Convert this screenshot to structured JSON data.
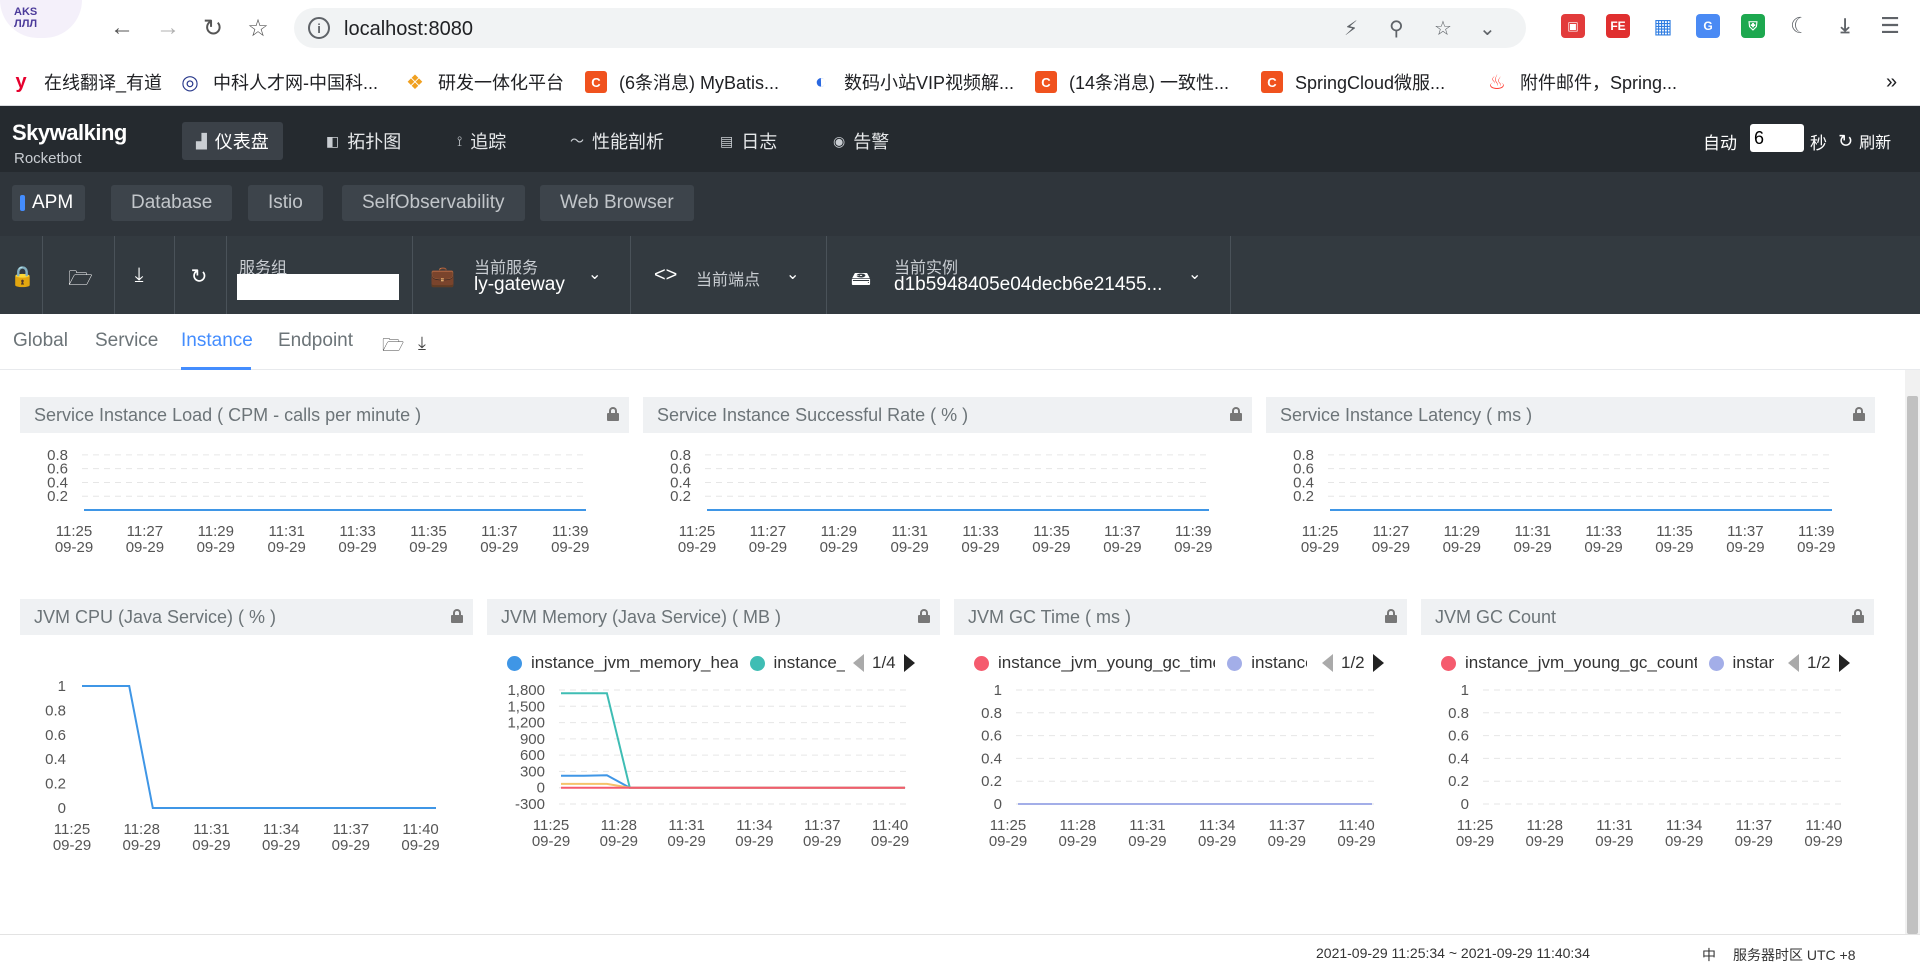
{
  "browser": {
    "url": "localhost:8080",
    "icons": [
      "back-icon",
      "forward-icon",
      "reload-icon",
      "bookmark-star-icon",
      "site-info-icon",
      "lightning-icon",
      "zoom-icon",
      "star-icon",
      "chevron-down-icon",
      "menu-icon"
    ]
  },
  "bookmarks": [
    {
      "label": "在线翻译_有道",
      "color": "#e6002d",
      "glyph": "y"
    },
    {
      "label": "中科人才网-中国科...",
      "color": "#2a3a8c",
      "glyph": "◎"
    },
    {
      "label": "研发一体化平台",
      "color": "#f0a020",
      "glyph": "❖"
    },
    {
      "label": "(6条消息) MyBatis...",
      "color": "#f0521e",
      "glyph": "C"
    },
    {
      "label": "数码小站VIP视频解...",
      "color": "#2a68e0",
      "glyph": "◐"
    },
    {
      "label": "(14条消息) 一致性...",
      "color": "#f0521e",
      "glyph": "C"
    },
    {
      "label": "SpringCloud微服...",
      "color": "#f0521e",
      "glyph": "C"
    },
    {
      "label": "附件邮件，Spring...",
      "color": "#ff3b30",
      "glyph": "♨"
    }
  ],
  "bookmarks_more": "»",
  "header": {
    "logo_title": "Skywalking",
    "logo_sub": "Rocketbot",
    "nav": [
      {
        "label": "仪表盘",
        "icon": "▟"
      },
      {
        "label": "拓扑图",
        "icon": "◧"
      },
      {
        "label": "追踪",
        "icon": "⟟"
      },
      {
        "label": "性能剖析",
        "icon": "〜"
      },
      {
        "label": "日志",
        "icon": "▤"
      },
      {
        "label": "告警",
        "icon": "◉"
      }
    ],
    "auto_label": "自动",
    "auto_value": "6",
    "sec_label": "秒",
    "refresh_label": "刷新"
  },
  "layers": [
    "APM",
    "Database",
    "Istio",
    "SelfObservability",
    "Web Browser"
  ],
  "toolbar": {
    "group_label": "服务组",
    "service_label": "当前服务",
    "service_value": "ly-gateway",
    "endpoint_label": "当前端点",
    "instance_label": "当前实例",
    "instance_value": "d1b5948405e04decb6e21455..."
  },
  "dash_tabs": [
    "Global",
    "Service",
    "Instance",
    "Endpoint"
  ],
  "footer": {
    "time_range": "2021-09-29 11:25:34 ~ 2021-09-29 11:40:34",
    "lang": "中",
    "timezone": "服务器时区 UTC +8"
  },
  "panels": {
    "load_title": "Service Instance Load ( CPM - calls per minute )",
    "sr_title": "Service Instance Successful Rate ( % )",
    "latency_title": "Service Instance Latency ( ms )",
    "cpu_title": "JVM CPU (Java Service) ( % )",
    "mem_title": "JVM Memory (Java Service) ( MB )",
    "gctime_title": "JVM GC Time ( ms )",
    "gccount_title": "JVM GC Count",
    "mem_legend": [
      "instance_jvm_memory_heap",
      "instance_jvm_memory_heap_max"
    ],
    "mem_page": "1/4",
    "gctime_legend": [
      "instance_jvm_young_gc_time",
      "instance_jvm_old_gc_time"
    ],
    "gctime_page": "1/2",
    "gccount_legend": [
      "instance_jvm_young_gc_count",
      "instance_jvm_old_gc_count"
    ],
    "gccount_page": "1/2"
  },
  "colors": {
    "accent": "#448dfe",
    "blue": "#3f96e6",
    "teal": "#3fbdb4",
    "orange": "#f5c26b",
    "red": "#f55b6e",
    "lavender": "#a3aee8"
  },
  "chart_data": [
    {
      "type": "line",
      "title": "Service Instance Load ( CPM - calls per minute )",
      "x": [
        "11:25\n09-29",
        "11:27\n09-29",
        "11:29\n09-29",
        "11:31\n09-29",
        "11:33\n09-29",
        "11:35\n09-29",
        "11:37\n09-29",
        "11:39\n09-29"
      ],
      "yticks": [
        0.2,
        0.4,
        0.6,
        0.8
      ],
      "ylim": [
        0,
        0.9
      ],
      "series": [
        {
          "values": [
            0,
            0,
            0,
            0,
            0,
            0,
            0,
            0,
            0,
            0,
            0,
            0,
            0,
            0,
            0,
            0
          ]
        }
      ]
    },
    {
      "type": "line",
      "title": "Service Instance Successful Rate ( % )",
      "x": [
        "11:25\n09-29",
        "11:27\n09-29",
        "11:29\n09-29",
        "11:31\n09-29",
        "11:33\n09-29",
        "11:35\n09-29",
        "11:37\n09-29",
        "11:39\n09-29"
      ],
      "yticks": [
        0.2,
        0.4,
        0.6,
        0.8
      ],
      "ylim": [
        0,
        0.9
      ],
      "series": [
        {
          "values": [
            0,
            0,
            0,
            0,
            0,
            0,
            0,
            0,
            0,
            0,
            0,
            0,
            0,
            0,
            0,
            0
          ]
        }
      ]
    },
    {
      "type": "line",
      "title": "Service Instance Latency ( ms )",
      "x": [
        "11:25\n09-29",
        "11:27\n09-29",
        "11:29\n09-29",
        "11:31\n09-29",
        "11:33\n09-29",
        "11:35\n09-29",
        "11:37\n09-29",
        "11:39\n09-29"
      ],
      "yticks": [
        0.2,
        0.4,
        0.6,
        0.8
      ],
      "ylim": [
        0,
        0.9
      ],
      "series": [
        {
          "values": [
            0,
            0,
            0,
            0,
            0,
            0,
            0,
            0,
            0,
            0,
            0,
            0,
            0,
            0,
            0,
            0
          ]
        }
      ]
    },
    {
      "type": "line",
      "title": "JVM CPU (Java Service) ( % )",
      "x": [
        "11:25\n09-29",
        "11:28\n09-29",
        "11:31\n09-29",
        "11:34\n09-29",
        "11:37\n09-29",
        "11:40\n09-29"
      ],
      "yticks": [
        0,
        0.2,
        0.4,
        0.6,
        0.8,
        1
      ],
      "ylim": [
        0,
        1
      ],
      "grid": false,
      "series": [
        {
          "values": [
            1,
            1,
            1,
            0,
            0,
            0,
            0,
            0,
            0,
            0,
            0,
            0,
            0,
            0,
            0,
            0
          ]
        }
      ]
    },
    {
      "type": "line",
      "title": "JVM Memory (Java Service) ( MB )",
      "x": [
        "11:25\n09-29",
        "11:28\n09-29",
        "11:31\n09-29",
        "11:34\n09-29",
        "11:37\n09-29",
        "11:40\n09-29"
      ],
      "yticks": [
        -300,
        0,
        300,
        600,
        900,
        1200,
        1500,
        1800
      ],
      "yticklabels": [
        "-300",
        "0",
        "300",
        "600",
        "900",
        "1,200",
        "1,500",
        "1,800"
      ],
      "ylim": [
        -300,
        1800
      ],
      "series": [
        {
          "name": "instance_jvm_memory_heap",
          "values": [
            220,
            220,
            230,
            0,
            0,
            0,
            0,
            0,
            0,
            0,
            0,
            0,
            0,
            0,
            0,
            0
          ]
        },
        {
          "name": "instance_jvm_memory_heap_max",
          "values": [
            1740,
            1740,
            1740,
            0,
            0,
            0,
            0,
            0,
            0,
            0,
            0,
            0,
            0,
            0,
            0,
            0
          ]
        },
        {
          "values": [
            70,
            70,
            70,
            0,
            0,
            0,
            0,
            0,
            0,
            0,
            0,
            0,
            0,
            0,
            0,
            0
          ]
        },
        {
          "values": [
            0,
            0,
            0,
            0,
            0,
            0,
            0,
            0,
            0,
            0,
            0,
            0,
            0,
            0,
            0,
            0
          ]
        }
      ]
    },
    {
      "type": "line",
      "title": "JVM GC Time ( ms )",
      "x": [
        "11:25\n09-29",
        "11:28\n09-29",
        "11:31\n09-29",
        "11:34\n09-29",
        "11:37\n09-29",
        "11:40\n09-29"
      ],
      "yticks": [
        0,
        0.2,
        0.4,
        0.6,
        0.8,
        1
      ],
      "ylim": [
        0,
        1
      ],
      "series": [
        {
          "name": "instance_jvm_young_gc_time",
          "values": [
            0,
            0,
            0,
            0,
            0,
            0,
            0,
            0,
            0,
            0,
            0,
            0,
            0,
            0,
            0,
            0
          ]
        },
        {
          "name": "instance_jvm_old_gc_time",
          "values": [
            0,
            0,
            0,
            0,
            0,
            0,
            0,
            0,
            0,
            0,
            0,
            0,
            0,
            0,
            0,
            0
          ]
        }
      ]
    },
    {
      "type": "line",
      "title": "JVM GC Count",
      "x": [
        "11:25\n09-29",
        "11:28\n09-29",
        "11:31\n09-29",
        "11:34\n09-29",
        "11:37\n09-29",
        "11:40\n09-29"
      ],
      "yticks": [
        0,
        0.2,
        0.4,
        0.6,
        0.8,
        1
      ],
      "ylim": [
        0,
        1
      ],
      "series": [
        {
          "name": "instance_jvm_young_gc_count",
          "values": []
        },
        {
          "name": "instance_jvm_old_gc_count",
          "values": []
        }
      ]
    }
  ]
}
